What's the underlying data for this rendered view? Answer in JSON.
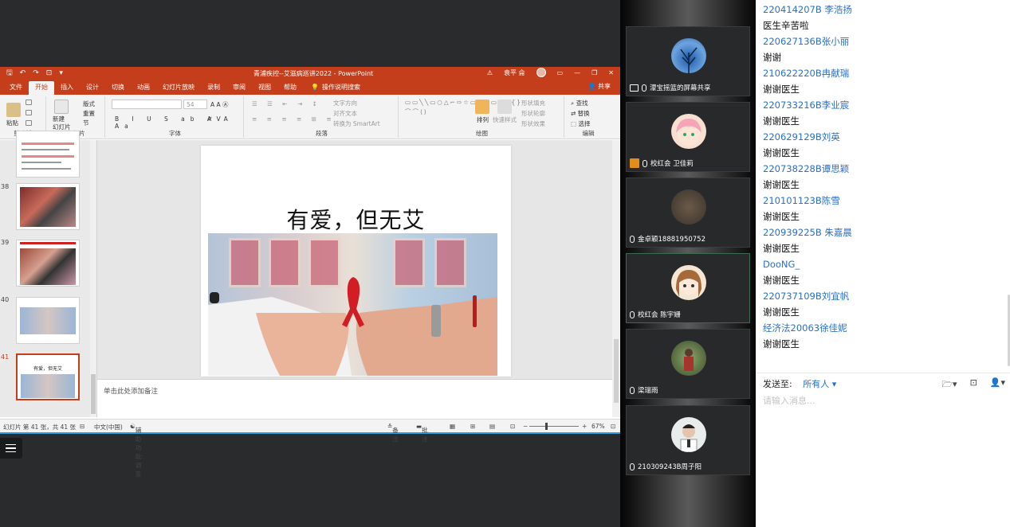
{
  "ppt": {
    "doc_title": "青浦疾控--艾滋病巡讲2022 - PowerPoint",
    "user_name": "袁平 侖",
    "tabs": [
      "文件",
      "开始",
      "插入",
      "设计",
      "切换",
      "动画",
      "幻灯片放映",
      "录制",
      "审阅",
      "视图",
      "帮助"
    ],
    "active_tab": "开始",
    "tell_me": "操作说明搜索",
    "share": "共享",
    "ribbon": {
      "paste": "粘贴",
      "clipboard": "剪贴板",
      "new_slide": "新建\n幻灯片",
      "layout": "版式",
      "reset": "重置",
      "section": "节",
      "slides": "幻灯片",
      "font_size": "54",
      "font_group": "字体",
      "text_direction": "文字方向",
      "align_text": "对齐文本",
      "smartart": "转换为 SmartArt",
      "paragraph": "段落",
      "arrange": "排列",
      "quick_styles": "快速样式",
      "shape_fill": "形状填充",
      "shape_outline": "形状轮廓",
      "shape_effects": "形状效果",
      "drawing": "绘图",
      "find": "查找",
      "replace": "替换",
      "select": "选择",
      "editing": "编辑"
    },
    "thumbs": [
      {
        "num": "",
        "title": ""
      },
      {
        "num": "38",
        "title": ""
      },
      {
        "num": "39",
        "title": ""
      },
      {
        "num": "40",
        "title": ""
      },
      {
        "num": "41",
        "title": "有爱，但无艾"
      }
    ],
    "slide": {
      "title": "有爱，但无艾"
    },
    "notes_placeholder": "单击此处添加备注",
    "status": {
      "slide_count": "幻灯片 第 41 张，共 41 张",
      "language": "中文(中国)",
      "accessibility": "辅助功能: 调查",
      "notes": "备注",
      "comments": "批注",
      "zoom": "67%"
    }
  },
  "participants": [
    {
      "name": "濛宝摇篮的屏幕共享",
      "type": "screen"
    },
    {
      "name": "校红会 卫佳莉",
      "type": "host"
    },
    {
      "name": "金卓颖18881950752",
      "type": "muted"
    },
    {
      "name": "校红会 陈宇姗",
      "type": "mic",
      "active": true
    },
    {
      "name": "梁瑞雨",
      "type": "mic"
    },
    {
      "name": "210309243B周子阳",
      "type": "muted"
    }
  ],
  "chat": {
    "messages": [
      {
        "kind": "name",
        "text": "220414207B 李浩扬"
      },
      {
        "kind": "text",
        "text": "医生辛苦啦"
      },
      {
        "kind": "name",
        "text": "220627136B张小丽"
      },
      {
        "kind": "text",
        "text": "谢谢"
      },
      {
        "kind": "name",
        "text": "210622220B冉献瑞"
      },
      {
        "kind": "text",
        "text": "谢谢医生"
      },
      {
        "kind": "name",
        "text": "220733216B李业宸"
      },
      {
        "kind": "text",
        "text": "谢谢医生"
      },
      {
        "kind": "name",
        "text": "220629129B刘英"
      },
      {
        "kind": "text",
        "text": "谢谢医生"
      },
      {
        "kind": "name",
        "text": "220738228B谭思颖"
      },
      {
        "kind": "text",
        "text": "谢谢医生"
      },
      {
        "kind": "name",
        "text": "210101123B陈雪"
      },
      {
        "kind": "text",
        "text": "谢谢医生"
      },
      {
        "kind": "name",
        "text": "220939225B 朱嘉晨"
      },
      {
        "kind": "text",
        "text": "谢谢医生"
      },
      {
        "kind": "name",
        "text": "DooNG_"
      },
      {
        "kind": "text",
        "text": "谢谢医生"
      },
      {
        "kind": "name",
        "text": "220737109B刘宜帆"
      },
      {
        "kind": "text",
        "text": "谢谢医生"
      },
      {
        "kind": "name",
        "text": "经济法20063徐佳妮"
      },
      {
        "kind": "text",
        "text": "谢谢医生"
      }
    ],
    "send_to_label": "发送至:",
    "send_to_target": "所有人 ▾",
    "input_placeholder": "请输入消息..."
  }
}
